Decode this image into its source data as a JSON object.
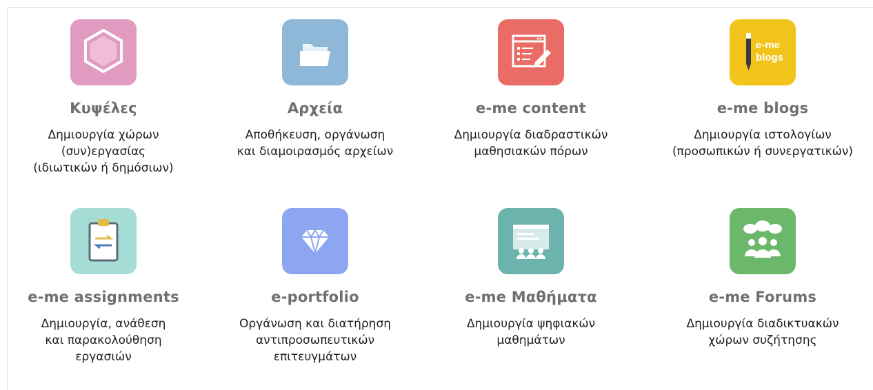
{
  "apps": [
    {
      "title": "Κυψέλες",
      "icon": "hexagon-icon",
      "color": "#e19ac0",
      "desc": [
        "Δημιουργία χώρων",
        "(συν)εργασίας",
        "(ιδιωτικών ή δημόσιων)"
      ]
    },
    {
      "title": "Αρχεία",
      "icon": "folder-icon",
      "color": "#8fb8d8",
      "desc": [
        "Αποθήκευση, οργάνωση",
        "και διαμοιρασμός αρχείων"
      ]
    },
    {
      "title": "e-me content",
      "icon": "content-editor-icon",
      "color": "#e96c66",
      "desc": [
        "Δημιουργία διαδραστικών",
        "μαθησιακών πόρων"
      ]
    },
    {
      "title": "e-me blogs",
      "icon": "blogs-icon",
      "icon_text": [
        "e-me",
        "blogs"
      ],
      "color": "#f2c31b",
      "desc": [
        "Δημιουργία ιστολογίων",
        "(προσωπικών ή συνεργατικών)"
      ]
    },
    {
      "title": "e-me assignments",
      "icon": "clipboard-icon",
      "color": "#a6dcd6",
      "desc": [
        "Δημιουργία, ανάθεση",
        "και παρακολούθηση",
        "εργασιών"
      ]
    },
    {
      "title": "e-portfolio",
      "icon": "diamond-icon",
      "color": "#8ea6f2",
      "desc": [
        "Οργάνωση και διατήρηση",
        "αντιπροσωπευτικών",
        "επιτευγμάτων"
      ]
    },
    {
      "title": "e-me Μαθήματα",
      "icon": "classroom-icon",
      "color": "#6bb3ac",
      "desc": [
        "Δημιουργία ψηφιακών",
        "μαθημάτων"
      ]
    },
    {
      "title": "e-me Forums",
      "icon": "forum-icon",
      "color": "#6bb86a",
      "desc": [
        "Δημιουργία διαδικτυακών",
        "χώρων συζήτησης"
      ]
    }
  ]
}
